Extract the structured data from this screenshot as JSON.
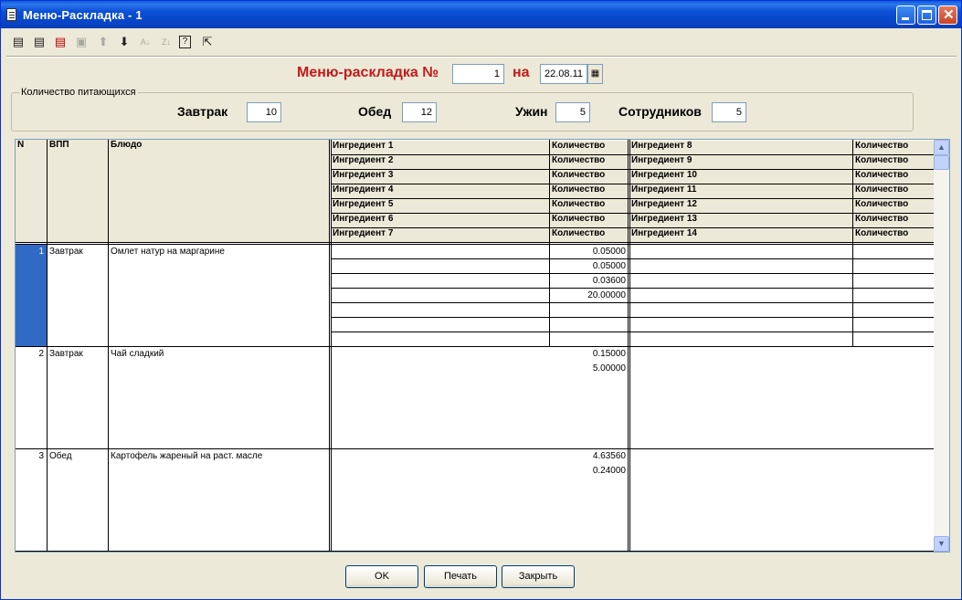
{
  "window": {
    "title": "Меню-Раскладка - 1"
  },
  "toolbar": {
    "icons": [
      "table-add-icon",
      "table-edit-icon",
      "table-delete-icon",
      "copy-icon",
      "arrow-up-icon",
      "arrow-down-icon",
      "sort-az-icon",
      "sort-za-icon",
      "help-icon",
      "pointer-help-icon"
    ]
  },
  "header": {
    "menu_label": "Меню-раскладка №",
    "menu_number": "1",
    "on_label": "на",
    "date": "22.08.11"
  },
  "counts": {
    "group_title": "Количество питающихся",
    "breakfast_label": "Завтрак",
    "breakfast_value": "10",
    "lunch_label": "Обед",
    "lunch_value": "12",
    "dinner_label": "Ужин",
    "dinner_value": "5",
    "staff_label": "Сотрудников",
    "staff_value": "5"
  },
  "grid": {
    "headers": {
      "n": "N",
      "vpp": "ВПП",
      "dish": "Блюдо",
      "left_ingredients": [
        "Ингредиент 1",
        "Ингредиент 2",
        "Ингредиент 3",
        "Ингредиент 4",
        "Ингредиент 5",
        "Ингредиент 6",
        "Ингредиент 7"
      ],
      "right_ingredients": [
        "Ингредиент 8",
        "Ингредиент 9",
        "Ингредиент 10",
        "Ингредиент 11",
        "Ингредиент 12",
        "Ингредиент 13",
        "Ингредиент 14"
      ],
      "qty": "Количество"
    },
    "rows": [
      {
        "n": "1",
        "vpp": "Завтрак",
        "dish": "Омлет натур на маргарине",
        "quantities": [
          "0.05000",
          "0.05000",
          "0.03600",
          "20.00000"
        ]
      },
      {
        "n": "2",
        "vpp": "Завтрак",
        "dish": "Чай сладкий",
        "quantities": [
          "0.15000",
          "5.00000"
        ]
      },
      {
        "n": "3",
        "vpp": "Обед",
        "dish": "Картофель жареный на раст. масле",
        "quantities": [
          "4.63560",
          "0.24000"
        ]
      }
    ]
  },
  "buttons": {
    "ok": "OK",
    "print": "Печать",
    "close": "Закрыть"
  }
}
